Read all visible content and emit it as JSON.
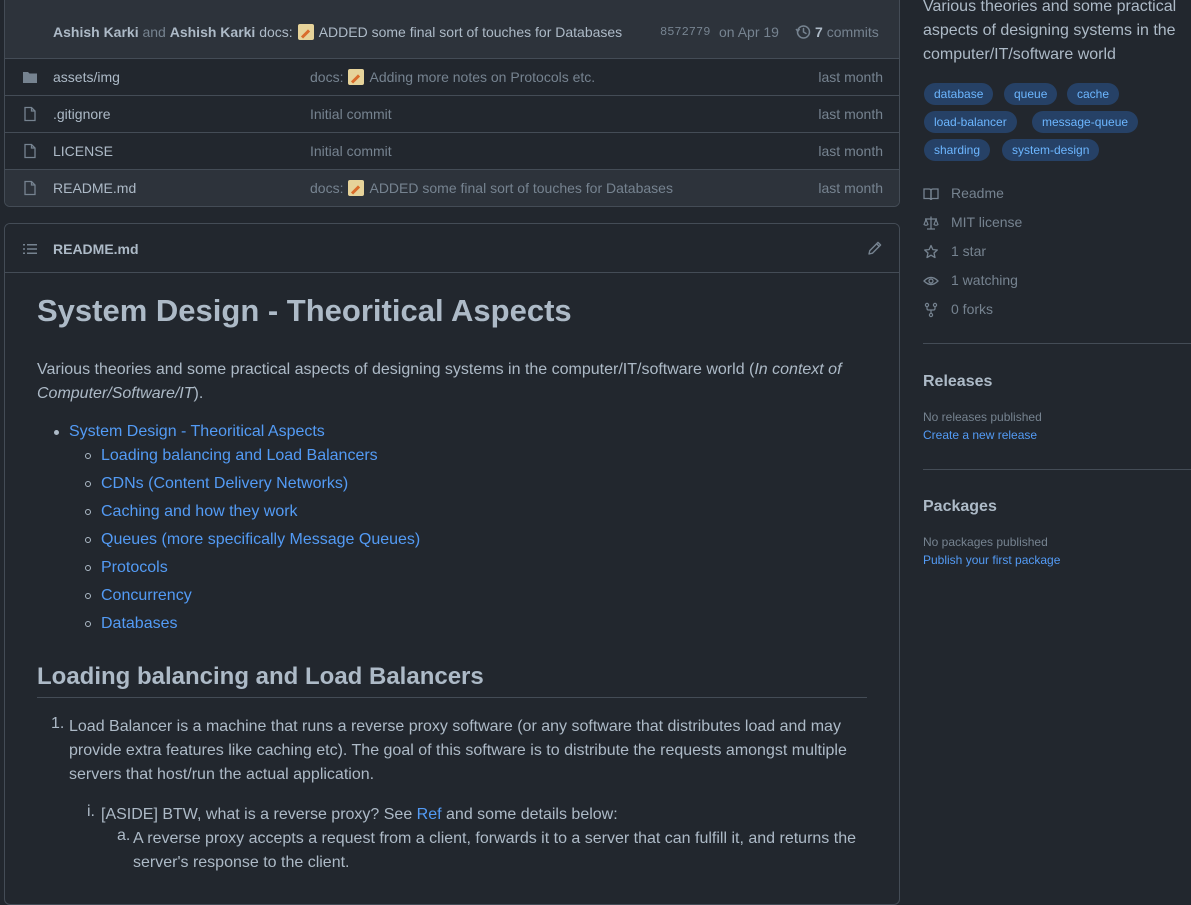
{
  "commit": {
    "author1": "Ashish Karki",
    "and": "and",
    "author2": "Ashish Karki",
    "msg_prefix": "docs:",
    "msg_text": "ADDED some final sort of touches for Databases",
    "sha": "8572779",
    "date": "on Apr 19",
    "commits_count": "7",
    "commits_label": "commits"
  },
  "files": [
    {
      "name_dir": "assets/",
      "name_leaf": "img",
      "msg_prefix": "docs:",
      "msg_text": "Adding more notes on Protocols etc.",
      "date": "last month"
    },
    {
      "name": ".gitignore",
      "msg": "Initial commit",
      "date": "last month"
    },
    {
      "name": "LICENSE",
      "msg": "Initial commit",
      "date": "last month"
    },
    {
      "name": "README.md",
      "msg_prefix": "docs:",
      "msg_text": "ADDED some final sort of touches for Databases",
      "date": "last month"
    }
  ],
  "readme": {
    "filename": "README.md",
    "h1": "System Design - Theoritical Aspects",
    "intro_plain": "Various theories and some practical aspects of designing systems in the computer/IT/software world (",
    "intro_italic": "In context of Computer/Software/IT",
    "intro_end": ").",
    "toc_top": "System Design - Theoritical Aspects",
    "toc": [
      "Loading balancing and Load Balancers",
      "CDNs (Content Delivery Networks)",
      "Caching and how they work",
      "Queues (more specifically Message Queues)",
      "Protocols",
      "Concurrency",
      "Databases"
    ],
    "h2": "Loading balancing and Load Balancers",
    "item1_num": "1.",
    "item1": "Load Balancer is a machine that runs a reverse proxy software (or any software that distributes load and may provide extra features like caching etc). The goal of this software is to distribute the requests amongst multiple servers that host/run the actual application.",
    "sub_num": "i.",
    "sub_pre": "[ASIDE] BTW, what is a reverse proxy? See ",
    "sub_link": "Ref",
    "sub_post": " and some details below:",
    "subsub_num": "a.",
    "subsub": "A reverse proxy accepts a request from a client, forwards it to a server that can fulfill it, and returns the server's response to the client."
  },
  "sidebar": {
    "about": "Various theories and some practical aspects of designing systems in the computer/IT/software world",
    "topics": [
      "database",
      "queue",
      "cache",
      "load-balancer",
      "message-queue",
      "sharding",
      "system-design"
    ],
    "readme": "Readme",
    "license": "MIT license",
    "stars": "1 star",
    "watching": "1 watching",
    "forks": "0 forks",
    "releases_title": "Releases",
    "releases_none": "No releases published",
    "releases_link": "Create a new release",
    "packages_title": "Packages",
    "packages_none": "No packages published",
    "packages_link": "Publish your first package"
  },
  "colors": {
    "background": "#22272e",
    "subtle_bg": "#2d333b",
    "border": "#444c56",
    "text": "#adbac7",
    "muted": "#768390",
    "link": "#539bf5",
    "topic_bg": "#264166",
    "topic_fg": "#6cb6ff"
  }
}
